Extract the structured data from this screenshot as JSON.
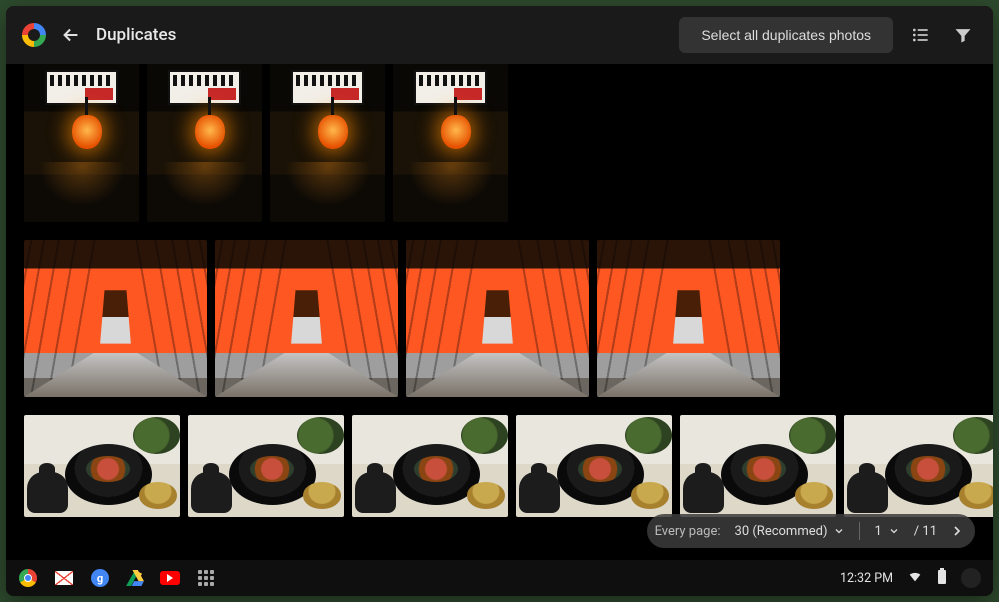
{
  "header": {
    "title": "Duplicates",
    "select_all_label": "Select all duplicates photos"
  },
  "pagination": {
    "every_page_label": "Every page:",
    "page_size_value": "30 (Recommed)",
    "current_page": "1",
    "total_pages_label": "/ 11"
  },
  "taskbar": {
    "clock": "12:32 PM",
    "google_letter": "g"
  }
}
